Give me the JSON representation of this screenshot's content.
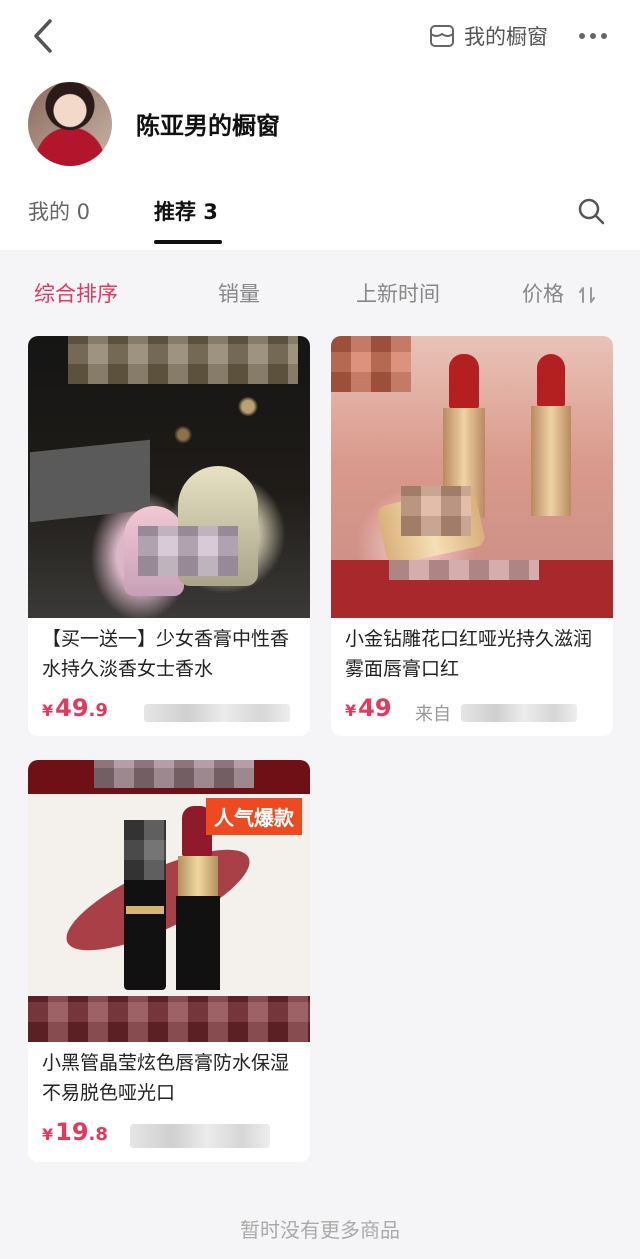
{
  "header": {
    "my_window_label": "我的橱窗",
    "shop_title": "陈亚男的橱窗"
  },
  "tabs": [
    {
      "label": "我的 0"
    },
    {
      "label": "推荐 3"
    }
  ],
  "sort": [
    {
      "label": "综合排序"
    },
    {
      "label": "销量"
    },
    {
      "label": "上新时间"
    },
    {
      "label": "价格"
    }
  ],
  "products": [
    {
      "title": "【买一送一】少女香膏中性香水持久淡香女士香水",
      "price_int": "49",
      "price_dec": ".9",
      "currency": "¥",
      "source": ""
    },
    {
      "title": "小金钻雕花口红哑光持久滋润雾面唇膏口红",
      "price_int": "49",
      "price_dec": "",
      "currency": "¥",
      "source": "来自"
    },
    {
      "title": "小黑管晶莹炫色唇膏防水保湿不易脱色哑光口",
      "price_int": "19",
      "price_dec": ".8",
      "currency": "¥",
      "source": "",
      "badge": "人气爆款"
    }
  ],
  "footer": {
    "note": "暂时没有更多商品"
  },
  "colors": {
    "accent": "#e8375a",
    "badge": "#ee4a22"
  },
  "icons": {
    "back": "chevron-left-icon",
    "window": "store-window-icon",
    "more": "more-dots-icon",
    "search": "search-icon",
    "sort": "sort-arrows-icon"
  }
}
